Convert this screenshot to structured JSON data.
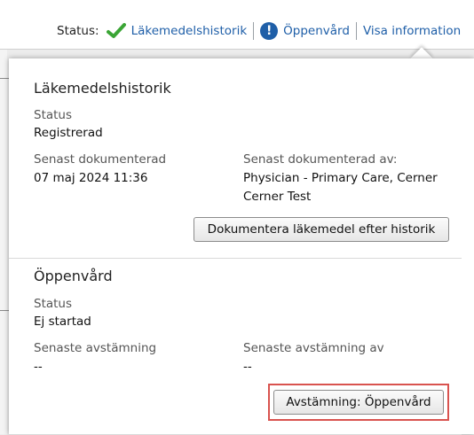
{
  "statusbar": {
    "status_label": "Status:",
    "items": [
      {
        "label": "Läkemedelshistorik",
        "icon": "checkmark-icon",
        "color": "#3aa535"
      },
      {
        "label": "Öppenvård",
        "icon": "alert-icon",
        "color": "#1f5fa8"
      },
      {
        "label": "Visa information"
      }
    ],
    "alert_glyph": "!"
  },
  "popover": {
    "history": {
      "title": "Läkemedelshistorik",
      "status_label": "Status",
      "status_value": "Registrerad",
      "documented_label": "Senast dokumenterad",
      "documented_value": "07 maj 2024 11:36",
      "documented_by_label": "Senast dokumenterad av:",
      "documented_by_value_line1": "Physician - Primary Care, Cerner",
      "documented_by_value_line2": "Cerner Test",
      "button_label": "Dokumentera läkemedel efter historik"
    },
    "outpatient": {
      "title": "Öppenvård",
      "status_label": "Status",
      "status_value": "Ej startad",
      "reconciliation_label": "Senaste avstämning",
      "reconciliation_value": "--",
      "reconciliation_by_label": "Senaste avstämning av",
      "reconciliation_by_value": "--",
      "button_label": "Avstämning: Öppenvård"
    }
  }
}
